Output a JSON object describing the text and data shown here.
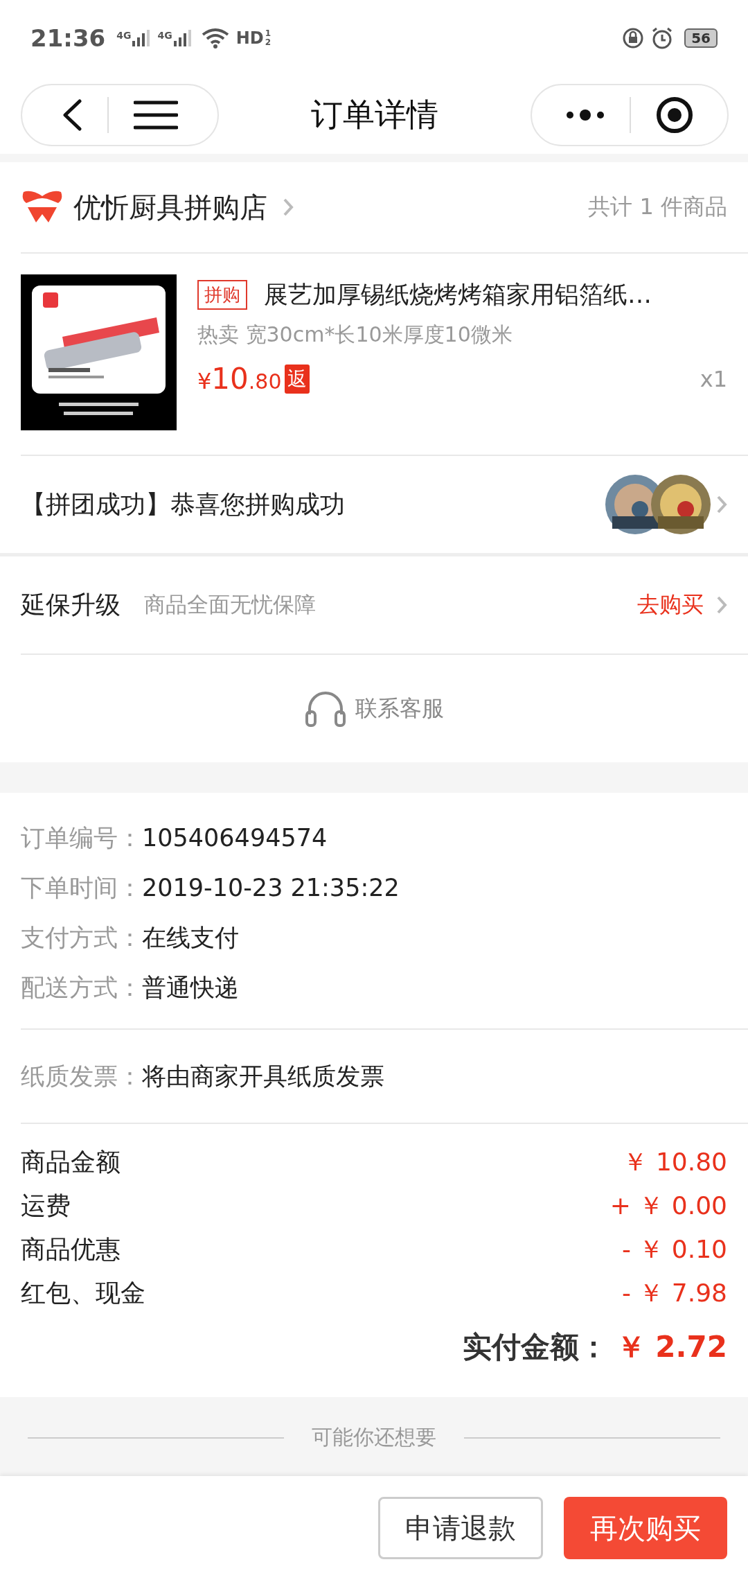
{
  "status_bar": {
    "time": "21:36",
    "sim_1": "4G",
    "sim_2": "4G",
    "hd": "HD",
    "hd_slots": [
      "1",
      "2"
    ],
    "battery": "56"
  },
  "nav": {
    "title": "订单详情"
  },
  "shop": {
    "name": "优忻厨具拼购店",
    "count": "共计 1 件商品"
  },
  "product": {
    "tag": "拼购",
    "title": "展艺加厚锡纸烧烤烤箱家用铝箔纸…",
    "spec": "热卖 宽30cm*长10米厚度10微米",
    "currency": "¥",
    "price_int": "10",
    "price_dec": ".80",
    "rebate": "返",
    "qty": "x1"
  },
  "group": {
    "text": "【拼团成功】恭喜您拼购成功"
  },
  "warranty": {
    "title": "延保升级",
    "desc": "商品全面无忧保障",
    "link": "去购买"
  },
  "service": {
    "label": "联系客服"
  },
  "order_info": [
    {
      "label": "订单编号：",
      "value": "105406494574"
    },
    {
      "label": "下单时间：",
      "value": "2019-10-23 21:35:22"
    },
    {
      "label": "支付方式：",
      "value": "在线支付"
    },
    {
      "label": "配送方式：",
      "value": "普通快递"
    }
  ],
  "invoice": {
    "label": "纸质发票：",
    "value": "将由商家开具纸质发票"
  },
  "amounts": [
    {
      "label": "商品金额",
      "value": "￥ 10.80"
    },
    {
      "label": "运费",
      "value": "+ ￥ 0.00"
    },
    {
      "label": "商品优惠",
      "value": "- ￥ 0.10"
    },
    {
      "label": "红包、现金",
      "value": "- ￥ 7.98"
    }
  ],
  "total": {
    "label": "实付金额：",
    "value": "￥ 2.72"
  },
  "recommend": {
    "title": "可能你还想要"
  },
  "buttons": [
    {
      "label": "申请退款",
      "kind": "outline"
    },
    {
      "label": "再次购买",
      "kind": "primary"
    }
  ]
}
